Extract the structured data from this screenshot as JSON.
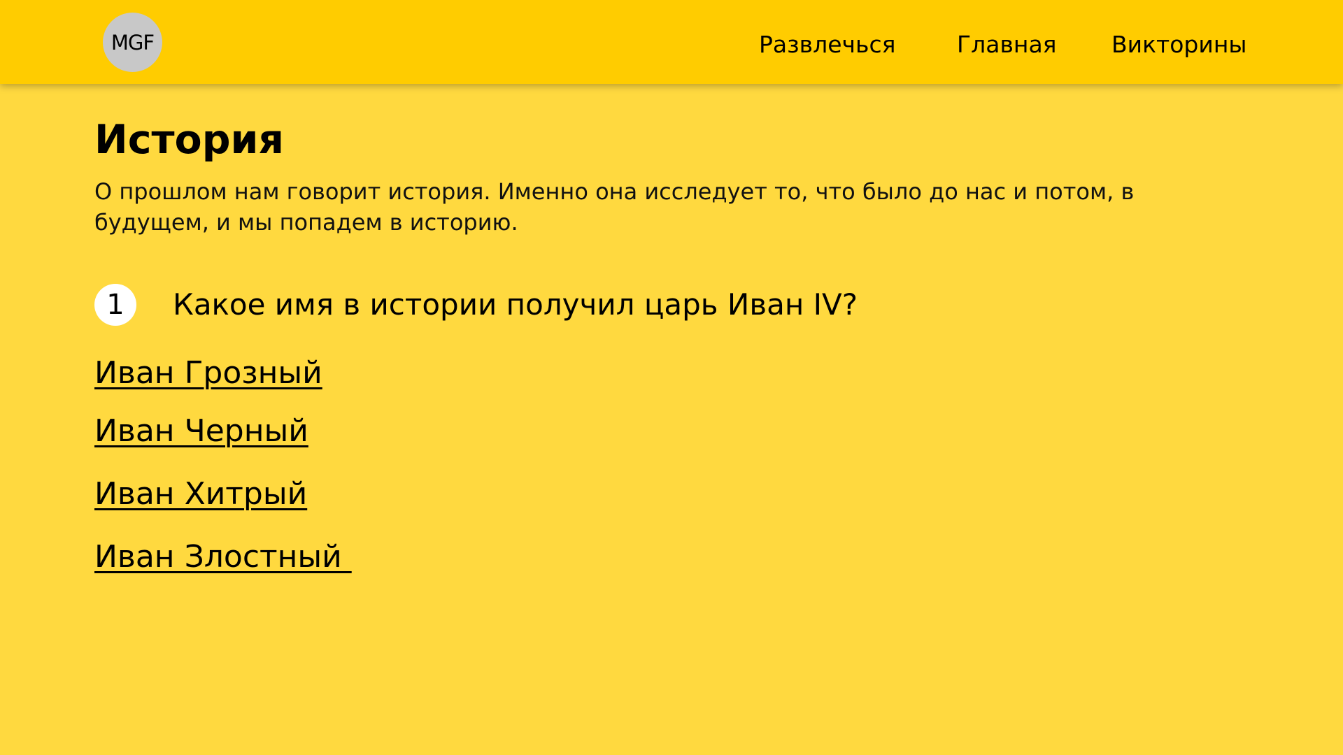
{
  "header": {
    "logo_text": "MGF",
    "nav": [
      {
        "label": "Развлечься"
      },
      {
        "label": "Главная"
      },
      {
        "label": "Викторины"
      }
    ]
  },
  "page": {
    "title": "История",
    "description": "О прошлом нам говорит история. Именно она исследует то, что было до нас и потом, в будущем, и мы попадем в историю."
  },
  "question": {
    "number": "1",
    "text": "Какое имя в истории получил царь Иван IV?",
    "answers": [
      {
        "label": "Иван Грозный"
      },
      {
        "label": "Иван Черный"
      },
      {
        "label": "Иван Хитрый"
      },
      {
        "label": "Иван Злостный "
      }
    ]
  },
  "colors": {
    "header_bg": "#FFCC00",
    "page_bg": "#FFD93F",
    "logo_bg": "#C8C8C8",
    "number_badge_bg": "#FFFFFF"
  }
}
